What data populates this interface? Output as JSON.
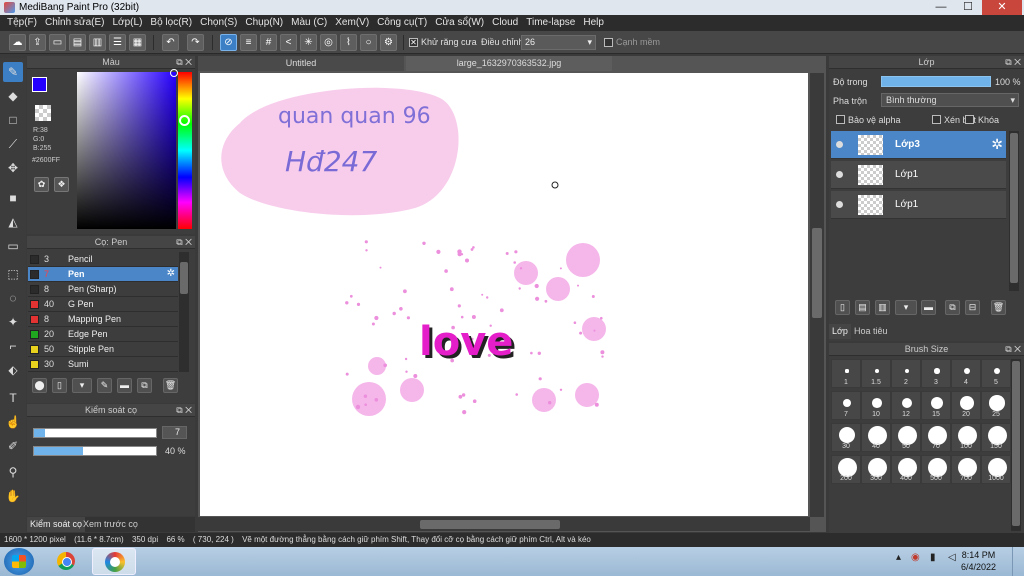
{
  "app": {
    "title": "MediBang Paint Pro (32bit)",
    "window_buttons": [
      "—",
      "☐",
      "✕"
    ]
  },
  "menu": [
    "Tệp(F)",
    "Chỉnh sửa(E)",
    "Lớp(L)",
    "Bộ lọc(R)",
    "Chọn(S)",
    "Chụp(N)",
    "Màu (C)",
    "Xem(V)",
    "Công cụ(T)",
    "Cửa sổ(W)",
    "Cloud",
    "Time-lapse",
    "Help"
  ],
  "toolbar": {
    "antialias_label": "Khử răng cưa",
    "adjust_label": "Điều chỉnh",
    "adjust_value": "26",
    "edge_label": "Cạnh mềm",
    "antialias_checked": true,
    "edge_checked": false
  },
  "color_panel": {
    "title": "Màu",
    "r": "R:38",
    "g": "G:0",
    "b": "B:255",
    "hex": "#2600FF",
    "fg_color": "#2600ff",
    "bg_color": "#111111"
  },
  "brush_panel": {
    "title": "Cọ: Pen",
    "brushes": [
      {
        "size": "3",
        "name": "Pencil",
        "color": "#2b2b2b",
        "selected": false
      },
      {
        "size": "7",
        "name": "Pen",
        "color": "#2b2b2b",
        "selected": true
      },
      {
        "size": "8",
        "name": "Pen (Sharp)",
        "color": "#2b2b2b",
        "selected": false
      },
      {
        "size": "40",
        "name": "G Pen",
        "color": "#e33232",
        "selected": false
      },
      {
        "size": "8",
        "name": "Mapping Pen",
        "color": "#e33232",
        "selected": false
      },
      {
        "size": "20",
        "name": "Edge Pen",
        "color": "#1fa81f",
        "selected": false
      },
      {
        "size": "50",
        "name": "Stipple Pen",
        "color": "#e8d21e",
        "selected": false
      },
      {
        "size": "30",
        "name": "Sumi",
        "color": "#e8d21e",
        "selected": false
      }
    ]
  },
  "brush_control": {
    "title": "Kiểm soát cọ",
    "size_value": "7",
    "size_fraction": 0.09,
    "opacity_label": "40 %",
    "opacity_fraction": 0.4
  },
  "bottom_tabs": [
    "Kiểm soát cọ",
    "Xem trước cọ"
  ],
  "doc_tabs": [
    "Untitled",
    "large_1632970363532.jpg"
  ],
  "canvas": {
    "handwriting_line1": "quan quan 96",
    "handwriting_line2": "Hđ247",
    "love_text": "love"
  },
  "layer_panel": {
    "title": "Lớp",
    "opacity_label": "Độ trong",
    "opacity_value": "100 %",
    "blend_label": "Pha trộn",
    "blend_value": "Bình thường",
    "protect_alpha": "Bảo vệ alpha",
    "clipping": "Xén bớt",
    "lock": "Khóa",
    "layers": [
      {
        "name": "Lớp3",
        "selected": true
      },
      {
        "name": "Lớp1",
        "selected": false
      },
      {
        "name": "Lớp1",
        "selected": false
      }
    ],
    "tabs": [
      "Lớp",
      "Hoa tiêu"
    ]
  },
  "brush_size": {
    "title": "Brush Size",
    "sizes": [
      "1",
      "1.5",
      "2",
      "3",
      "4",
      "5",
      "7",
      "10",
      "12",
      "15",
      "20",
      "25",
      "30",
      "40",
      "50",
      "70",
      "100",
      "150",
      "200",
      "300",
      "400",
      "500",
      "700",
      "1000"
    ]
  },
  "status": {
    "dimensions": "1600 * 1200 pixel",
    "physical": "(11.6 * 8.7cm)",
    "dpi": "350 dpi",
    "zoom": "66 %",
    "coords": "( 730, 224 )",
    "hint": "Vẽ một đường thẳng bằng cách giữ phím Shift, Thay đổi cỡ cọ bằng cách giữ phím Ctrl, Alt và kéo"
  },
  "taskbar": {
    "time": "8:14 PM",
    "date": "6/4/2022"
  }
}
